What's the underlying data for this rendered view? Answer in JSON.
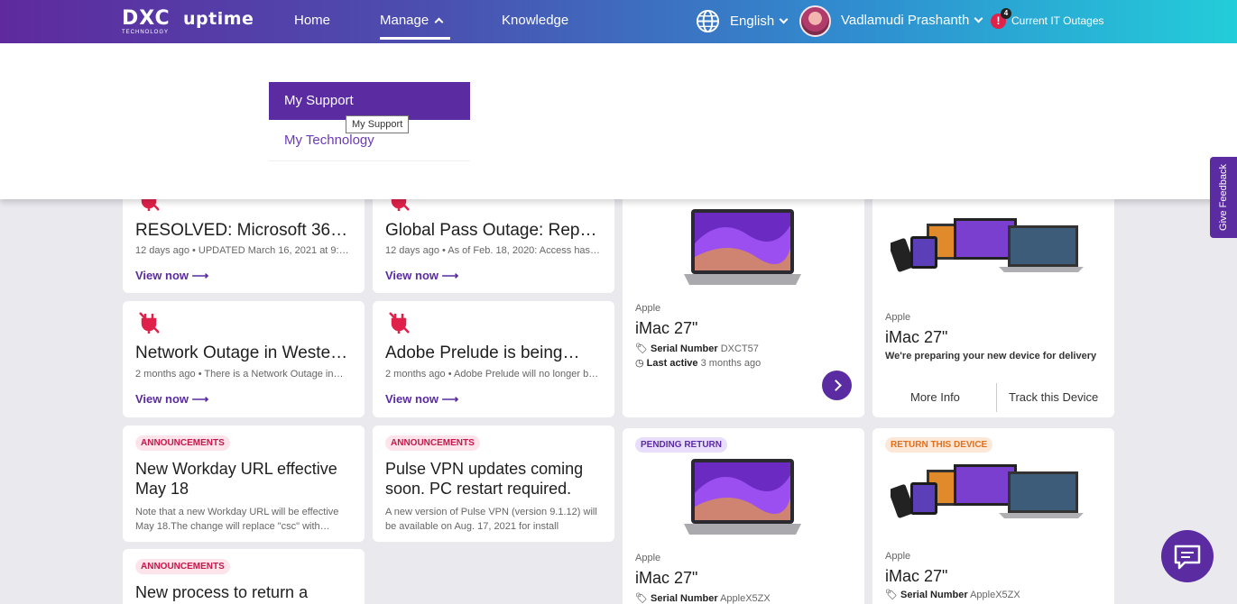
{
  "header": {
    "logo_dxc": "DXC",
    "logo_tech": "TECHNOLOGY",
    "logo_uptime": "uptime",
    "nav": {
      "home": "Home",
      "manage": "Manage",
      "knowledge": "Knowledge"
    },
    "language": "English",
    "user_name": "Vadlamudi Prashanth",
    "alert_count": "4",
    "alert_mark": "!",
    "outages_label": "Current IT Outages"
  },
  "dropdown": {
    "items": [
      "My Support",
      "My Technology"
    ],
    "tooltip": "My Support"
  },
  "feedback_label": "Give Feedback",
  "cards": {
    "outage1": {
      "title": "RESOLVED: Microsoft 365…",
      "meta": "12 days ago • UPDATED March 16, 2021 at 9:0…",
      "link": "View now"
    },
    "outage2": {
      "title": "Global Pass Outage: Repor…",
      "meta": "12 days ago • As of Feb. 18, 2020: Access has…",
      "link": "View now"
    },
    "outage3": {
      "title": "Network Outage in Western…",
      "meta": "2 months ago • There is a Network Outage in…",
      "link": "View now"
    },
    "outage4": {
      "title": "Adobe Prelude is being…",
      "meta": "2 months ago • Adobe Prelude will no longer be…",
      "link": "View now"
    },
    "ann1": {
      "badge": "ANNOUNCEMENTS",
      "title": "New Workday URL effective May 18",
      "desc": "Note that a new Workday URL will be effective May 18.The change will replace \"csc\" with…"
    },
    "ann2": {
      "badge": "ANNOUNCEMENTS",
      "title": "Pulse VPN updates coming soon. PC restart required.",
      "desc": "A new version of Pulse VPN (version 9.1.12) will be available on Aug. 17, 2021 for install followin…"
    },
    "ann3": {
      "badge": "ANNOUNCEMENTS",
      "title": "New process to return a"
    }
  },
  "devices": {
    "d1": {
      "brand": "Apple",
      "model": "iMac 27\"",
      "serial_label": "Serial Number",
      "serial": "DXCT57",
      "active_label": "Last active",
      "active": "3 months ago"
    },
    "d2": {
      "brand": "Apple",
      "model": "iMac 27\"",
      "note": "We're preparing your new device for delivery",
      "more": "More Info",
      "track": "Track this Device"
    },
    "d3": {
      "badge": "PENDING RETURN",
      "brand": "Apple",
      "model": "iMac 27\"",
      "serial_label": "Serial Number",
      "serial": "AppleX5ZX"
    },
    "d4": {
      "badge": "RETURN THIS DEVICE",
      "brand": "Apple",
      "model": "iMac 27\"",
      "serial_label": "Serial Number",
      "serial": "AppleX5ZX"
    }
  },
  "colors": {
    "brand_purple": "#5b2ba2",
    "alert_red": "#e0214a"
  }
}
